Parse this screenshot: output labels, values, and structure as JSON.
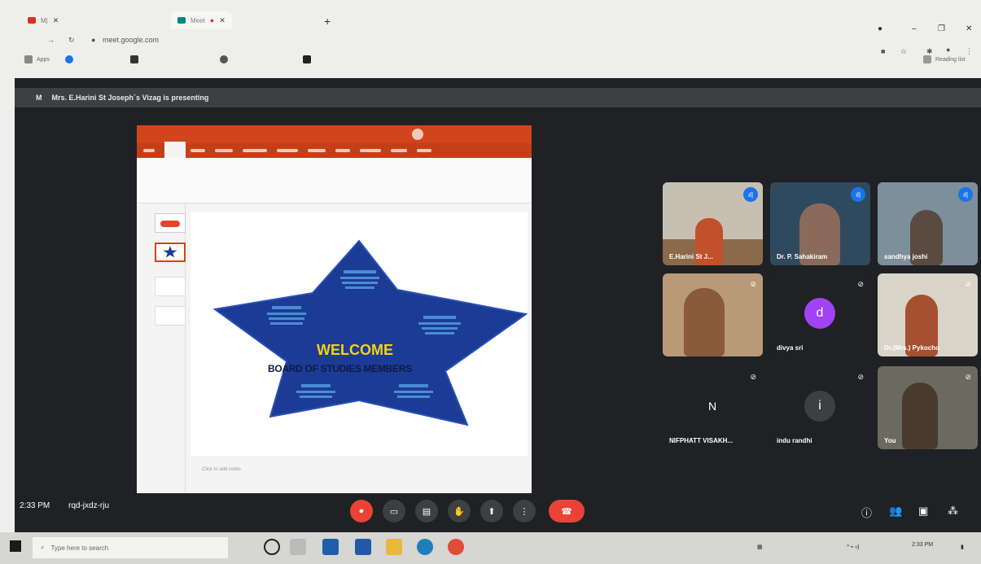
{
  "browser": {
    "tabs": [
      {
        "label": "M| ",
        "active": false
      },
      {
        "label": "Meet",
        "active": true
      }
    ],
    "address": "meet.google.com",
    "bookmarks": [
      "Apps",
      "",
      "",
      "",
      ""
    ],
    "reading_list": "Reading list"
  },
  "meet": {
    "presenter_text": "Mrs. E.Harini St Joseph`s Vizag is presenting",
    "time": "2:33 PM",
    "code": "rqd-jxdz-rju",
    "slide": {
      "welcome": "WELCOME",
      "subtitle": "BOARD OF STUDIES MEMBERS",
      "notes_placeholder": "Click to add notes"
    },
    "participants": [
      {
        "name": "E.Harini St J..."
      },
      {
        "name": "Dr. P. Sahakiram"
      },
      {
        "name": "sandhya joshi"
      },
      {
        "name": ""
      },
      {
        "name": "divya sri",
        "initial": "d"
      },
      {
        "name": "Dr.(Mrs.) Pykocho"
      },
      {
        "name": "NIFPHATT VISAKH...",
        "initial": "N"
      },
      {
        "name": "indu randhi",
        "initial": "i"
      },
      {
        "name": "You"
      }
    ]
  },
  "taskbar": {
    "search_placeholder": "Type here to search",
    "clock": "2:33 PM"
  },
  "colors": {
    "meet_bg": "#202124",
    "end_call": "#ea4335",
    "ppt_orange": "#d0451b",
    "star_blue": "#1c3b94",
    "welcome_yellow": "#f2d21b",
    "avatar_purple": "#a142f4"
  }
}
